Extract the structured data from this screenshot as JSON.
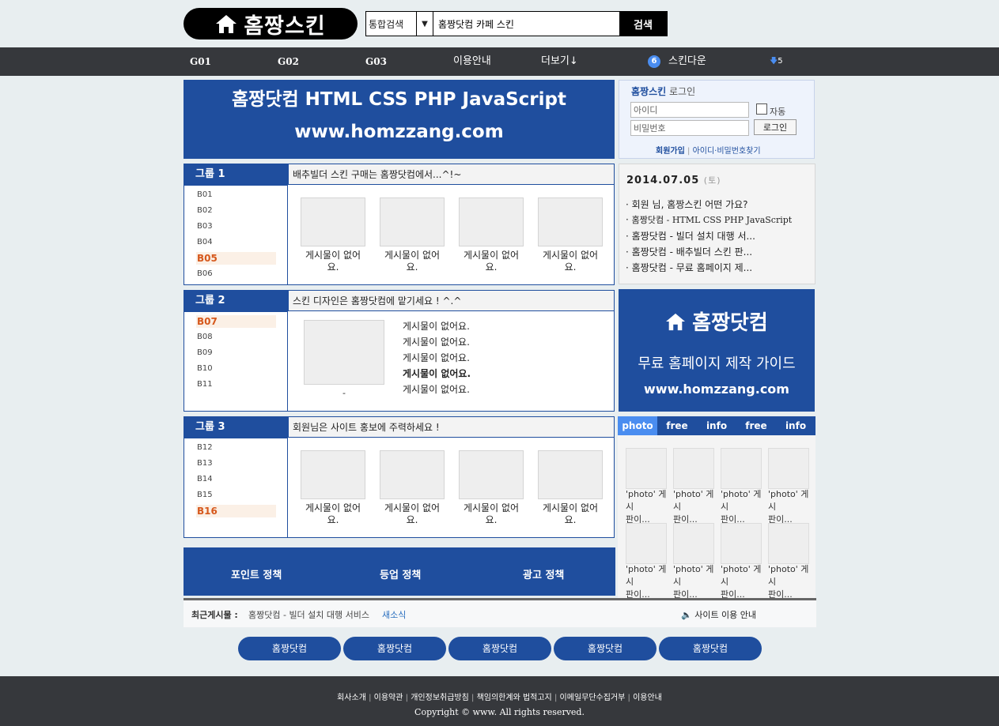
{
  "header": {
    "logo_text": "홈짱스킨",
    "search_scope": "통합검색",
    "search_value": "홈짱닷컴 카페 스킨",
    "search_button": "검색"
  },
  "nav": {
    "items": [
      "G01",
      "G02",
      "G03",
      "이용안내",
      "더보기↓"
    ],
    "skin_badge": "6",
    "skin_download": "스킨다운",
    "download_count": "5"
  },
  "banner_top": {
    "line1": "홈짱닷컴 HTML CSS PHP JavaScript",
    "line2": "www.homzzang.com"
  },
  "login": {
    "title_bold": "홈짱스킨",
    "title": "로그인",
    "id_placeholder": "아이디",
    "pw_placeholder": "비밀번호",
    "auto": "자동",
    "login_button": "로그인",
    "register": "회원가입",
    "find": "아이디·비밀번호찾기"
  },
  "groups": [
    {
      "title": "그룹 1",
      "notice": "배추빌더 스킨 구매는 홈짱닷컴에서...^!~",
      "boards": [
        "B01",
        "B02",
        "B03",
        "B04",
        "B05",
        "B06"
      ],
      "active": "B05",
      "captions": [
        "게시물이 없어요.",
        "게시물이 없어요.",
        "게시물이 없어요.",
        "게시물이 없어요."
      ]
    },
    {
      "title": "그룹 2",
      "notice": "스킨 디자인은 홈짱닷컴에 맡기세요 ! ^.^",
      "boards": [
        "B07",
        "B08",
        "B09",
        "B10",
        "B11"
      ],
      "active": "B07",
      "thumb_caption": "-",
      "list": [
        "게시물이 없어요.",
        "게시물이 없어요.",
        "게시물이 없어요.",
        "게시물이 없어요.",
        "게시물이 없어요."
      ]
    },
    {
      "title": "그룹 3",
      "notice": "회원님은 사이트 홍보에 주력하세요 !",
      "boards": [
        "B12",
        "B13",
        "B14",
        "B15",
        "B16"
      ],
      "active": "B16",
      "captions": [
        "게시물이 없어요.",
        "게시물이 없어요.",
        "게시물이 없어요.",
        "게시물이 없어요."
      ]
    }
  ],
  "info": {
    "date": "2014.07.05",
    "weekday": "(토)",
    "lines": [
      "회원 님, 홈짱스킨 어떤 가요?",
      "홈짱닷컴 - HTML CSS PHP JavaScript",
      "홈짱닷컴 - 빌더 설치 대행 서...",
      "홈짱닷컴 - 배추빌더 스킨 판...",
      "홈짱닷컴 - 무료 홈페이지 제..."
    ]
  },
  "banner_side": {
    "title": "홈짱닷컴",
    "subtitle": "무료 홈페이지 제작 가이드",
    "url": "www.homzzang.com"
  },
  "tabs": {
    "labels": [
      "photo",
      "free",
      "info",
      "free",
      "info"
    ],
    "caption_line1": "'photo' 게시",
    "caption_line2": "판이..."
  },
  "policy": [
    "포인트 정책",
    "등업 정책",
    "광고 정책"
  ],
  "recent": {
    "label": "최근게시물 :",
    "text": "홈짱닷컴 - 빌더 설치 대행 서비스",
    "new": "새소식",
    "notice": "사이트 이용 안내"
  },
  "pills": [
    "홈짱닷컴",
    "홈짱닷컴",
    "홈짱닷컴",
    "홈짱닷컴",
    "홈짱닷컴"
  ],
  "footer": {
    "links": [
      "회사소개",
      "이용약관",
      "개인정보취급방침",
      "책임의한계와 법적고지",
      "이메일무단수집거부",
      "이용안내"
    ],
    "copyright": "Copyright © www. All rights reserved."
  },
  "colors": {
    "primary": "#1f4e9e",
    "active_tab": "#4a8df0",
    "nav_bg": "#36383c",
    "active_board": "#d6581c",
    "page_bg": "#e8eef0"
  }
}
